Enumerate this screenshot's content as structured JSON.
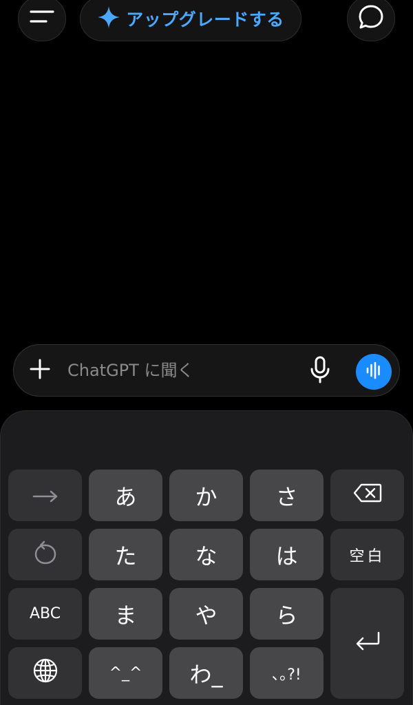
{
  "header": {
    "menu_icon": "menu-icon",
    "upgrade_icon": "sparkle-icon",
    "upgrade_label": "アップグレードする",
    "chat_icon": "chat-bubble-icon",
    "accent_color": "#4aa8ff"
  },
  "composer": {
    "placeholder": "ChatGPT に聞く",
    "value": "",
    "add_icon": "plus-icon",
    "mic_icon": "microphone-icon",
    "voice_icon": "voice-waveform-icon",
    "voice_button_color": "#1a8cff"
  },
  "keyboard": {
    "row1": [
      "→",
      "あ",
      "か",
      "さ",
      "⌫"
    ],
    "row2": [
      "↺",
      "た",
      "な",
      "は",
      "空白"
    ],
    "row3": [
      "ABC",
      "ま",
      "や",
      "ら"
    ],
    "row4": [
      "🌐",
      "^_^",
      "わ_",
      "､｡?!"
    ],
    "enter_icon": "return-icon"
  }
}
